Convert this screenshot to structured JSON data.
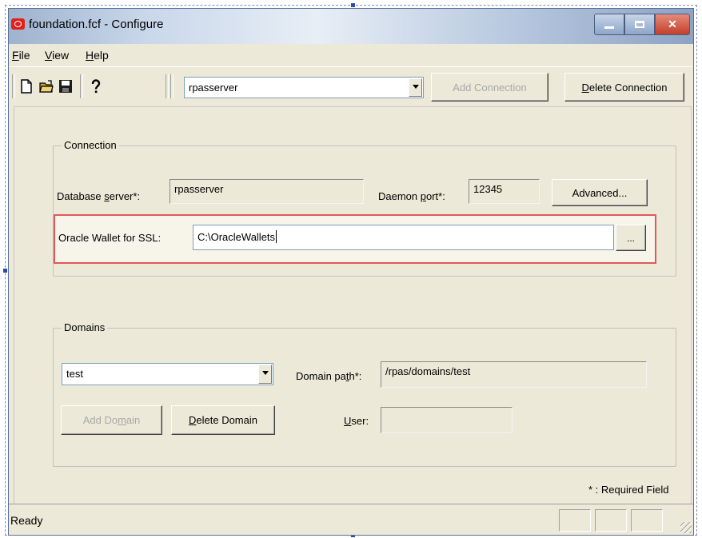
{
  "window": {
    "title": "foundation.fcf - Configure"
  },
  "menu": [
    {
      "label": "File",
      "mnemonic": "F",
      "rest": "ile"
    },
    {
      "label": "View",
      "mnemonic": "V",
      "rest": "iew"
    },
    {
      "label": "Help",
      "mnemonic": "H",
      "rest": "elp"
    }
  ],
  "toolbar": {
    "icons": [
      "new-file-icon",
      "open-folder-icon",
      "save-disk-icon",
      "help-question-icon"
    ],
    "connection_select": "rpasserver",
    "add_connection": "Add Connection",
    "delete_connection_mnemonic": "D",
    "delete_connection_rest": "elete Connection"
  },
  "connection": {
    "group_label": "Connection",
    "db_server_label_pre": "Database ",
    "db_server_label_mn": "s",
    "db_server_label_post": "erver*:",
    "db_server_value": "rpasserver",
    "daemon_port_label_pre": "Daemon ",
    "daemon_port_label_mn": "p",
    "daemon_port_label_post": "ort*:",
    "daemon_port_value": "12345",
    "advanced_button": "Advanced...",
    "wallet_label": "Oracle Wallet for SSL:",
    "wallet_value": "C:\\OracleWallets",
    "browse_button": "...",
    "highlight_color": "#e05a5a"
  },
  "domains": {
    "group_label": "Domains",
    "domain_select": "test",
    "domain_path_label_pre": "Domain pa",
    "domain_path_label_mn": "t",
    "domain_path_label_post": "h*:",
    "domain_path_value": "/rpas/domains/test",
    "add_domain_pre": "Add Do",
    "add_domain_mn": "m",
    "add_domain_post": "ain",
    "delete_domain_mn": "D",
    "delete_domain_rest": "elete Domain",
    "user_label_mn": "U",
    "user_label_rest": "ser:",
    "user_value": ""
  },
  "required_note": "* : Required Field",
  "status": {
    "text": "Ready"
  }
}
